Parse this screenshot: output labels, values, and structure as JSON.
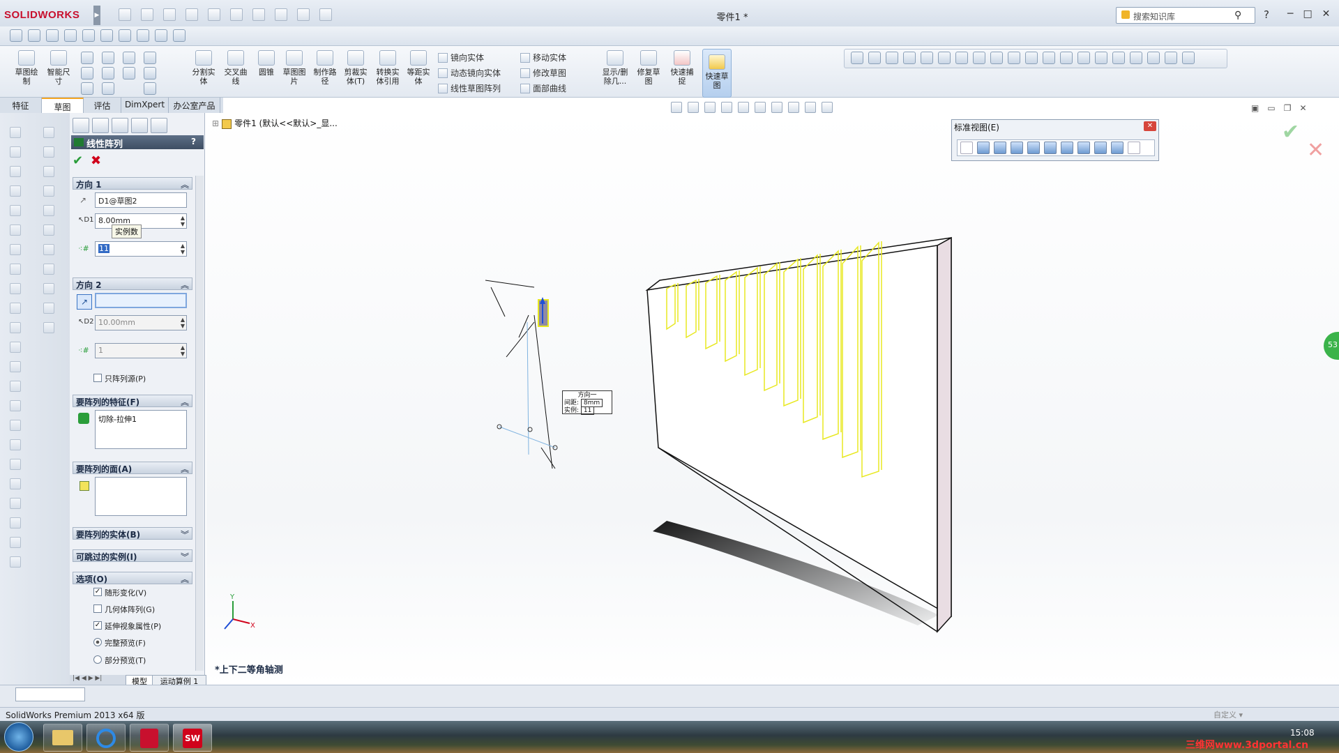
{
  "app": {
    "logo": "SOLIDWORKS",
    "logo_arrow": "▶",
    "doc_title": "零件1 *",
    "search_placeholder": "搜索知识库",
    "help": "?",
    "win_min": "─",
    "win_max": "□",
    "win_close": "✕"
  },
  "ribbon": {
    "buttons": [
      {
        "label": "草图绘\n制"
      },
      {
        "label": "智能尺\n寸"
      },
      {
        "label": "分割实\n体"
      },
      {
        "label": "交叉曲\n线"
      },
      {
        "label": "圆锥"
      },
      {
        "label": "草图图\n片"
      },
      {
        "label": "制作路\n径"
      },
      {
        "label": "剪裁实\n体(T)"
      },
      {
        "label": "转换实\n体引用"
      },
      {
        "label": "等距实\n体"
      },
      {
        "label": "显示/删\n除几..."
      },
      {
        "label": "修复草\n图"
      },
      {
        "label": "快速捕\n捉"
      },
      {
        "label": "快速草\n图"
      }
    ],
    "small": {
      "mirror": "镜向实体",
      "dyn_mirror": "动态镜向实体",
      "linear_pattern": "线性草图阵列",
      "move": "移动实体",
      "modify": "修改草图",
      "face_curve": "面部曲线"
    }
  },
  "tabs": [
    "特征",
    "草图",
    "评估",
    "DimXpert",
    "办公室产品"
  ],
  "active_tab": "草图",
  "pm": {
    "title": "线性阵列",
    "help": "?",
    "ok": "✔",
    "cancel": "✖",
    "dir1": {
      "header": "方向 1",
      "chev": "︽",
      "ref": "D1@草图2",
      "spacing": "8.00mm",
      "count": "11",
      "tooltip": "实例数"
    },
    "dir2": {
      "header": "方向 2",
      "chev": "︽",
      "ref": "",
      "spacing": "10.00mm",
      "count": "1",
      "pattern_seed_only": "只阵列源(P)"
    },
    "features": {
      "header": "要阵列的特征(F)",
      "chev": "︽",
      "item": "切除-拉伸1"
    },
    "faces": {
      "header": "要阵列的面(A)",
      "chev": "︽"
    },
    "bodies": {
      "header": "要阵列的实体(B)",
      "chev": "︾"
    },
    "skip": {
      "header": "可跳过的实例(I)",
      "chev": "︾"
    },
    "options": {
      "header": "选项(O)",
      "chev": "︽",
      "vary_sketch": "随形变化(V)",
      "geometry_pattern": "几何体阵列(G)",
      "propagate": "延伸视象属性(P)",
      "full_preview": "完整预览(F)",
      "partial_preview": "部分预览(T)"
    }
  },
  "canvas": {
    "tree_label": "零件1 (默认<<默认>_显...",
    "std_views_title": "标准视图(E)",
    "std_views_close": "✕",
    "view_label": "*上下二等角轴测",
    "callout_title": "方向一",
    "callout_spacing_label": "间距:",
    "callout_spacing": "8mm",
    "callout_count_label": "实例:",
    "callout_count": "11",
    "check": "✔",
    "x": "✕",
    "green_badge": "53"
  },
  "bottom_tabs": {
    "model": "模型",
    "motion": "运动算例 1"
  },
  "status": {
    "text": "SolidWorks Premium 2013 x64 版",
    "right": "自定义 ▾"
  },
  "taskbar": {
    "clock": "15:08",
    "watermark": "三维网www.3dportal.cn"
  }
}
